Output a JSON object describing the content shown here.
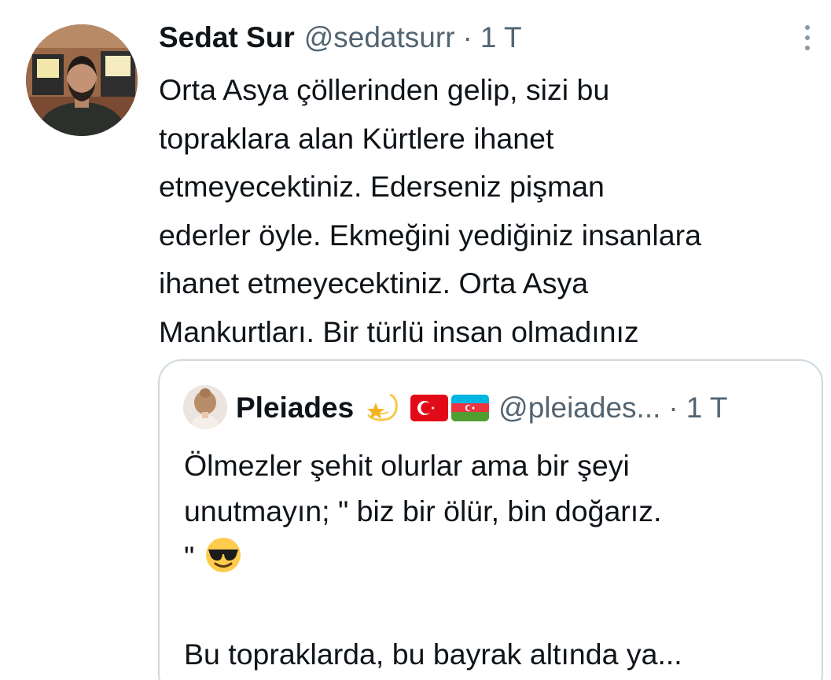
{
  "tweet": {
    "author_name": "Sedat Sur",
    "author_handle": "@sedatsurr",
    "separator": "·",
    "time": "1 T",
    "more_icon": "more-vertical-icon",
    "text_lines": [
      "Orta Asya çöllerinden gelip, sizi bu",
      "topraklara alan Kürtlere ihanet",
      "etmeyecektiniz. Ederseniz pişman",
      "ederler öyle. Ekmeğini yediğiniz insanlara",
      "ihanet etmeyecektiniz. Orta Asya",
      "Mankurtları. Bir türlü insan olmadınız"
    ]
  },
  "quote": {
    "author_name": "Pleiades",
    "name_emojis": [
      "dizzy-star-icon",
      "turkey-flag-icon",
      "azerbaijan-flag-icon"
    ],
    "author_handle": "@pleiades...",
    "separator": "·",
    "time": "1 T",
    "text_lines": [
      "Ölmezler şehit olurlar ama bir şeyi",
      "unutmayın; \" biz bir ölür, bin doğarız.",
      "\"",
      "",
      "Bu topraklarda, bu bayrak altında ya..."
    ],
    "line3_emoji": "sunglasses-face-icon"
  },
  "colors": {
    "text_primary": "#0f1419",
    "text_secondary": "#536471",
    "border": "#cfd9de",
    "turkey_red": "#e30a17",
    "az_blue": "#00b5e2",
    "az_red": "#ef3340",
    "az_green": "#509e2f"
  }
}
